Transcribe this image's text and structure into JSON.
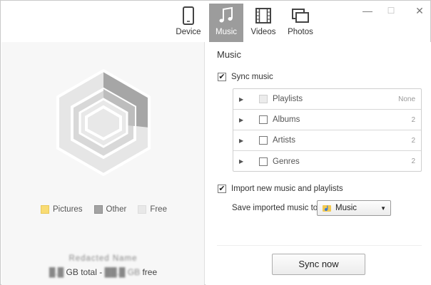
{
  "nav": {
    "tabs": [
      {
        "label": "Device",
        "icon": "phone-icon",
        "active": false
      },
      {
        "label": "Music",
        "icon": "music-note-icon",
        "active": true
      },
      {
        "label": "Videos",
        "icon": "film-icon",
        "active": false
      },
      {
        "label": "Photos",
        "icon": "photos-icon",
        "active": false
      }
    ],
    "window_controls": {
      "minimize": "—",
      "maximize": "☐",
      "close": "✕"
    }
  },
  "storage": {
    "legend": [
      {
        "label": "Pictures",
        "color": "#f9dc74"
      },
      {
        "label": "Other",
        "color": "#a3a3a3"
      },
      {
        "label": "Free",
        "color": "#e8e8e8"
      }
    ],
    "device_name": "Redacted Name",
    "total": "█.█",
    "total_suffix": "GB total",
    "separator": "-",
    "free": "██.█ GB",
    "free_suffix": "free"
  },
  "music": {
    "title": "Music",
    "sync_music": {
      "label": "Sync music",
      "checked": true
    },
    "categories": [
      {
        "label": "Playlists",
        "count": "None",
        "disabled": true
      },
      {
        "label": "Albums",
        "count": "2",
        "disabled": false
      },
      {
        "label": "Artists",
        "count": "2",
        "disabled": false
      },
      {
        "label": "Genres",
        "count": "2",
        "disabled": false
      }
    ],
    "import": {
      "label": "Import new music and playlists",
      "checked": true
    },
    "save_to": {
      "label": "Save imported music to",
      "value": "Music",
      "icon": "music-folder-icon"
    },
    "sync_button": "Sync now"
  },
  "colors": {
    "active_tab": "#9c9c9c",
    "pictures": "#f9dc74",
    "other": "#a3a3a3",
    "free": "#e8e8e8"
  }
}
